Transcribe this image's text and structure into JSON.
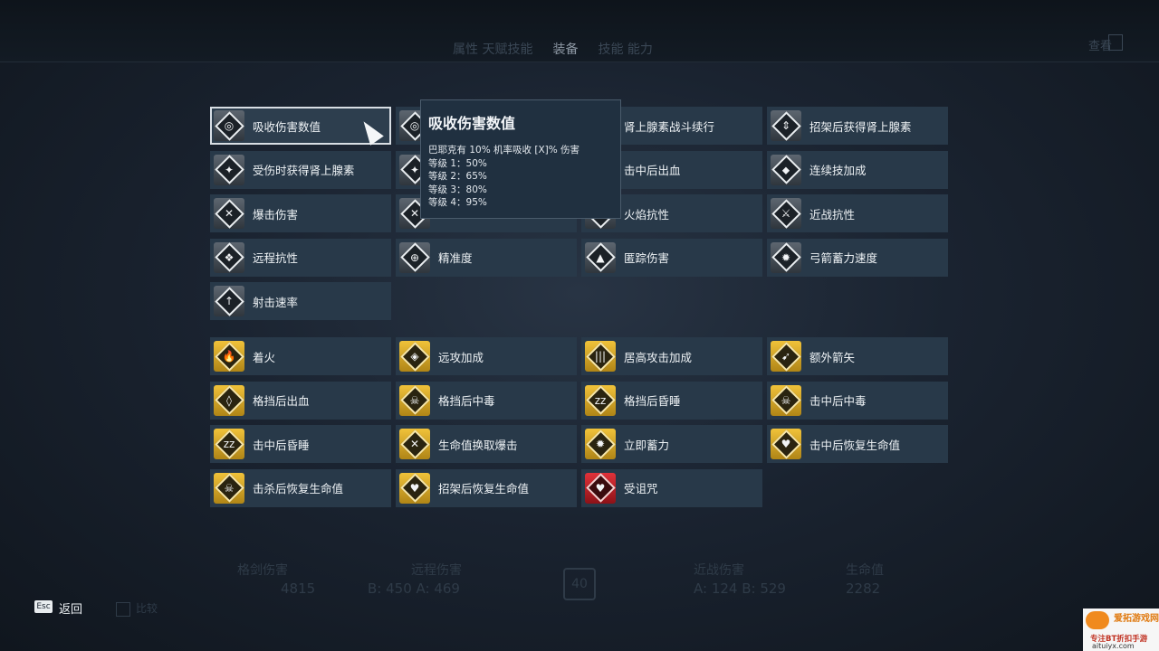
{
  "fps": "137",
  "top_bar": {
    "tab_prev": "属性 天赋技能",
    "tab_active": "装备",
    "tab_next": "技能 能力",
    "right_text": "查看"
  },
  "perks_gray": [
    {
      "label": "吸收伤害数值",
      "icon": "absorb-damage-icon",
      "glyph": "◎",
      "selected": true
    },
    {
      "label": "",
      "icon": "perk-icon",
      "glyph": "◎"
    },
    {
      "label": "肾上腺素战斗续行",
      "icon": "adrenaline-icon",
      "glyph": "✦"
    },
    {
      "label": "招架后获得肾上腺素",
      "icon": "parry-adrenaline-icon",
      "glyph": "⇕"
    },
    {
      "label": "受伤时获得肾上腺素",
      "icon": "hurt-adrenaline-icon",
      "glyph": "✦"
    },
    {
      "label": "",
      "icon": "perk-icon",
      "glyph": "✦"
    },
    {
      "label": "击中后出血",
      "icon": "hit-bleed-icon",
      "glyph": "◉"
    },
    {
      "label": "连续技加成",
      "icon": "combo-bonus-icon",
      "glyph": "⬥"
    },
    {
      "label": "爆击伤害",
      "icon": "critical-damage-icon",
      "glyph": "✕"
    },
    {
      "label": "",
      "icon": "perk-icon",
      "glyph": "✕"
    },
    {
      "label": "火焰抗性",
      "icon": "fire-resist-icon",
      "glyph": "♨"
    },
    {
      "label": "近战抗性",
      "icon": "melee-resist-icon",
      "glyph": "⚔"
    },
    {
      "label": "远程抗性",
      "icon": "ranged-resist-icon",
      "glyph": "❖"
    },
    {
      "label": "精准度",
      "icon": "precision-icon",
      "glyph": "⊕"
    },
    {
      "label": "匿踪伤害",
      "icon": "stealth-damage-icon",
      "glyph": "▲"
    },
    {
      "label": "弓箭蓄力速度",
      "icon": "bow-charge-icon",
      "glyph": "✹"
    },
    {
      "label": "射击速率",
      "icon": "fire-rate-icon",
      "glyph": "↑"
    }
  ],
  "perks_gold": [
    {
      "label": "着火",
      "icon": "ignite-icon",
      "glyph": "🔥",
      "color": "gold"
    },
    {
      "label": "远攻加成",
      "icon": "ranged-bonus-icon",
      "glyph": "◈",
      "color": "gold"
    },
    {
      "label": "居高攻击加成",
      "icon": "high-ground-icon",
      "glyph": "|||",
      "color": "gold"
    },
    {
      "label": "额外箭矢",
      "icon": "extra-arrows-icon",
      "glyph": "➹",
      "color": "gold"
    },
    {
      "label": "格挡后出血",
      "icon": "block-bleed-icon",
      "glyph": "◊",
      "color": "gold"
    },
    {
      "label": "格挡后中毒",
      "icon": "block-poison-icon",
      "glyph": "☠",
      "color": "gold"
    },
    {
      "label": "格挡后昏睡",
      "icon": "block-sleep-icon",
      "glyph": "zz",
      "color": "gold"
    },
    {
      "label": "击中后中毒",
      "icon": "hit-poison-icon",
      "glyph": "☠",
      "color": "gold"
    },
    {
      "label": "击中后昏睡",
      "icon": "hit-sleep-icon",
      "glyph": "zz",
      "color": "gold"
    },
    {
      "label": "生命值换取爆击",
      "icon": "health-for-crit-icon",
      "glyph": "✕",
      "color": "gold"
    },
    {
      "label": "立即蓄力",
      "icon": "instant-charge-icon",
      "glyph": "✹",
      "color": "gold"
    },
    {
      "label": "击中后恢复生命值",
      "icon": "hit-heal-icon",
      "glyph": "♥",
      "color": "gold"
    },
    {
      "label": "击杀后恢复生命值",
      "icon": "kill-heal-icon",
      "glyph": "☠",
      "color": "gold"
    },
    {
      "label": "招架后恢复生命值",
      "icon": "parry-heal-icon",
      "glyph": "♥",
      "color": "gold"
    },
    {
      "label": "受诅咒",
      "icon": "cursed-icon",
      "glyph": "♥",
      "color": "red"
    }
  ],
  "tooltip": {
    "title": "吸收伤害数值",
    "desc": "巴耶克有 10% 机率吸收 [X]% 伤害",
    "levels": [
      "等级 1：50%",
      "等级 2：65%",
      "等级 3：80%",
      "等级 4：95%"
    ]
  },
  "stats": [
    {
      "label": "格剑伤害",
      "value": "4815"
    },
    {
      "label": "远程伤害",
      "value": "B: 450  A: 469"
    },
    {
      "label": "近战伤害",
      "value": "A: 124  B: 529"
    },
    {
      "label": "生命值",
      "value": "2282"
    }
  ],
  "level": "40",
  "footer": {
    "esc_key": "Esc",
    "back_label": "返回",
    "ghost_label": "比较"
  },
  "watermark": {
    "line1": "爱拓游戏网",
    "line2": "专注BT折扣手游",
    "line3": "aituiyx.com"
  },
  "colors": {
    "cell_bg": "#283949",
    "gold": "#e8b430",
    "red": "#d0262e",
    "selected_border": "#d8dee4"
  }
}
